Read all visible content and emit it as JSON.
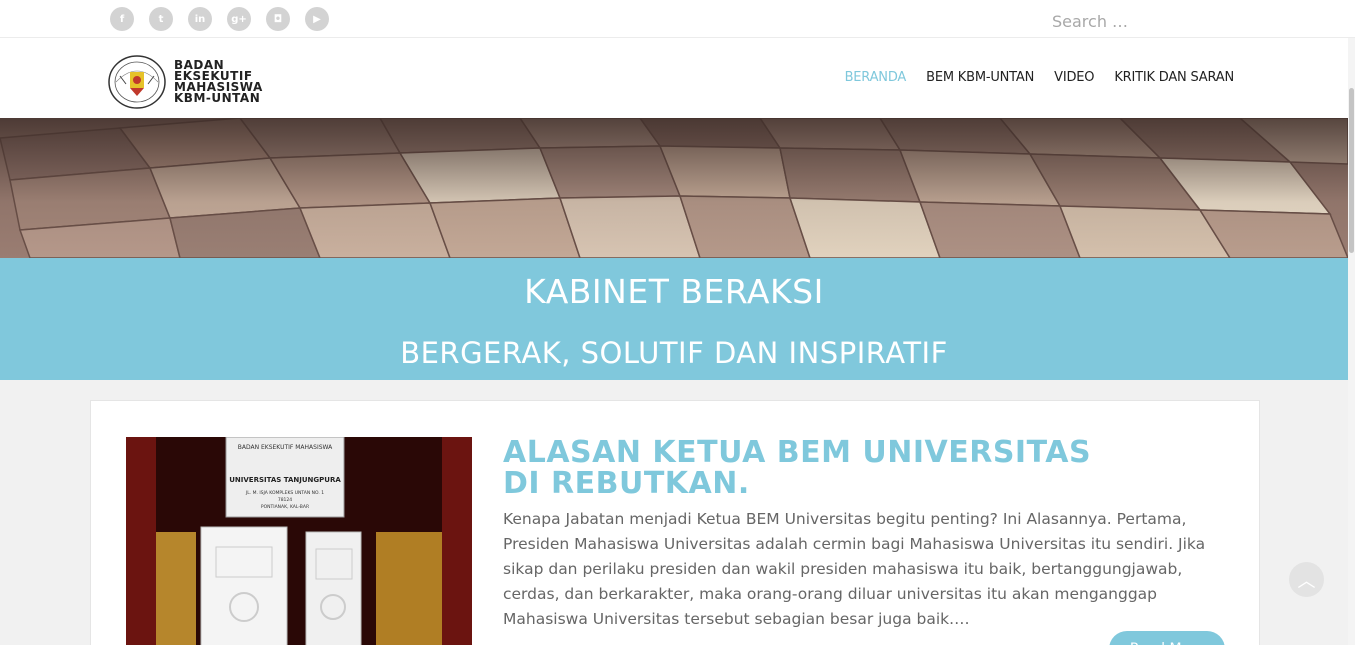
{
  "topbar": {
    "socials": [
      {
        "icon": "facebook-icon",
        "glyph": "f"
      },
      {
        "icon": "twitter-icon",
        "glyph": "t"
      },
      {
        "icon": "linkedin-icon",
        "glyph": "in"
      },
      {
        "icon": "google-plus-icon",
        "glyph": "g+"
      },
      {
        "icon": "instagram-icon",
        "glyph": "◘"
      },
      {
        "icon": "youtube-icon",
        "glyph": "▶"
      }
    ],
    "search_placeholder": "Search …"
  },
  "logo": {
    "line1": "BADAN",
    "line2": "EKSEKUTIF",
    "line3": "MAHASISWA",
    "line4": "KBM-UNTAN"
  },
  "nav": {
    "items": [
      "BERANDA",
      "BEM KBM-UNTAN",
      "VIDEO",
      "KRITIK DAN SARAN"
    ],
    "active": "BERANDA"
  },
  "banner": {
    "title": "KABINET BERAKSI",
    "subtitle": "BERGERAK, SOLUTIF DAN INSPIRATIF"
  },
  "post": {
    "title": "ALASAN KETUA BEM UNIVERSITAS DI REBUTKAN.",
    "excerpt": "Kenapa Jabatan menjadi Ketua BEM Universitas begitu penting? Ini Alasannya. Pertama, Presiden Mahasiswa Universitas adalah cermin bagi Mahasiswa Universitas itu sendiri. Jika sikap dan perilaku presiden dan wakil presiden mahasiswa itu baik, bertanggungjawab, cerdas, dan berkarakter, maka orang-orang diluar universitas itu akan menganggap Mahasiswa Universitas tersebut sebagian besar juga baik.…",
    "read_more": "Read More",
    "image_sign": {
      "arc": "BADAN EKSEKUTIF MAHASISWA",
      "name": "UNIVERSITAS TANJUNGPURA",
      "address": "JL. M. ISJA KOMPLEKS UNTAN NO. 1",
      "zip": "78124",
      "city": "PONTIANAK, KAL-BAR"
    }
  },
  "colors": {
    "accent": "#80c8dc",
    "text": "#666666"
  }
}
